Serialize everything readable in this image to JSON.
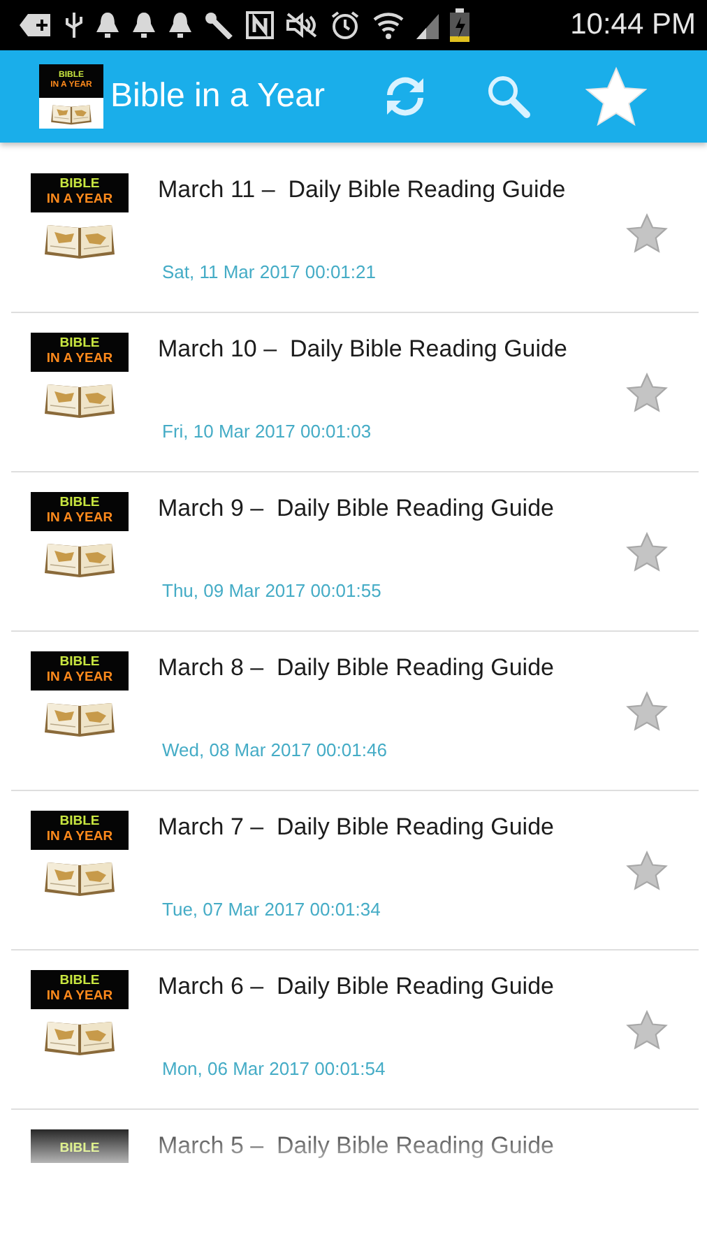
{
  "status_bar": {
    "time": "10:44 PM"
  },
  "app_bar": {
    "logo_lines": [
      "BIBLE",
      "IN A YEAR"
    ],
    "title": "Bible in a Year"
  },
  "readings": [
    {
      "thumb_lines": [
        "BIBLE",
        "IN A YEAR"
      ],
      "title": "March 11 –  Daily Bible Reading Guide",
      "date": "Sat, 11 Mar 2017 00:01:21",
      "favorite": false
    },
    {
      "thumb_lines": [
        "BIBLE",
        "IN A YEAR"
      ],
      "title": "March 10 –  Daily Bible Reading Guide",
      "date": "Fri, 10 Mar 2017 00:01:03",
      "favorite": false
    },
    {
      "thumb_lines": [
        "BIBLE",
        "IN A YEAR"
      ],
      "title": "March 9 –  Daily Bible Reading Guide",
      "date": "Thu, 09 Mar 2017 00:01:55",
      "favorite": false
    },
    {
      "thumb_lines": [
        "BIBLE",
        "IN A YEAR"
      ],
      "title": "March 8 –  Daily Bible Reading Guide",
      "date": "Wed, 08 Mar 2017 00:01:46",
      "favorite": false
    },
    {
      "thumb_lines": [
        "BIBLE",
        "IN A YEAR"
      ],
      "title": "March 7 –  Daily Bible Reading Guide",
      "date": "Tue, 07 Mar 2017 00:01:34",
      "favorite": false
    },
    {
      "thumb_lines": [
        "BIBLE",
        "IN A YEAR"
      ],
      "title": "March 6 –  Daily Bible Reading Guide",
      "date": "Mon, 06 Mar 2017 00:01:54",
      "favorite": false
    },
    {
      "thumb_lines": [
        "BIBLE"
      ],
      "title": "March 5 –  Daily Bible Reading Guide"
    }
  ]
}
